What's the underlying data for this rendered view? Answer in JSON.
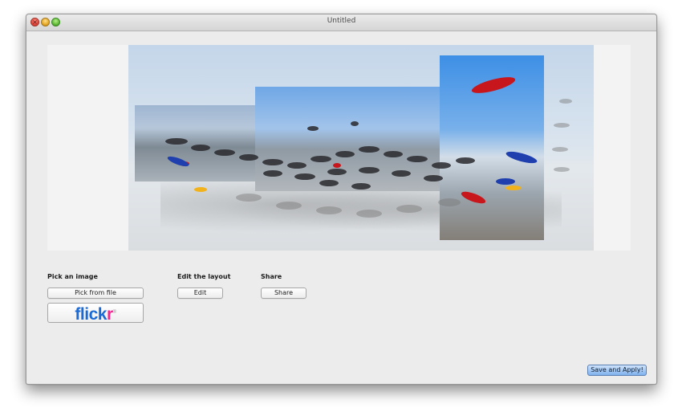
{
  "window": {
    "title": "Untitled",
    "close_glyph": "×"
  },
  "sections": {
    "pick": {
      "title": "Pick an image",
      "file_button": "Pick from file",
      "flickr": {
        "part1": "flick",
        "part2": "r",
        "mark": "®"
      }
    },
    "edit": {
      "title": "Edit the layout",
      "button": "Edit"
    },
    "share": {
      "title": "Share",
      "button": "Share"
    }
  },
  "footer": {
    "apply_button": "Save and Apply!"
  },
  "colors": {
    "flickr_blue": "#1a6ad6",
    "flickr_pink": "#f0288c",
    "primary_button": "#7fb2ef"
  }
}
